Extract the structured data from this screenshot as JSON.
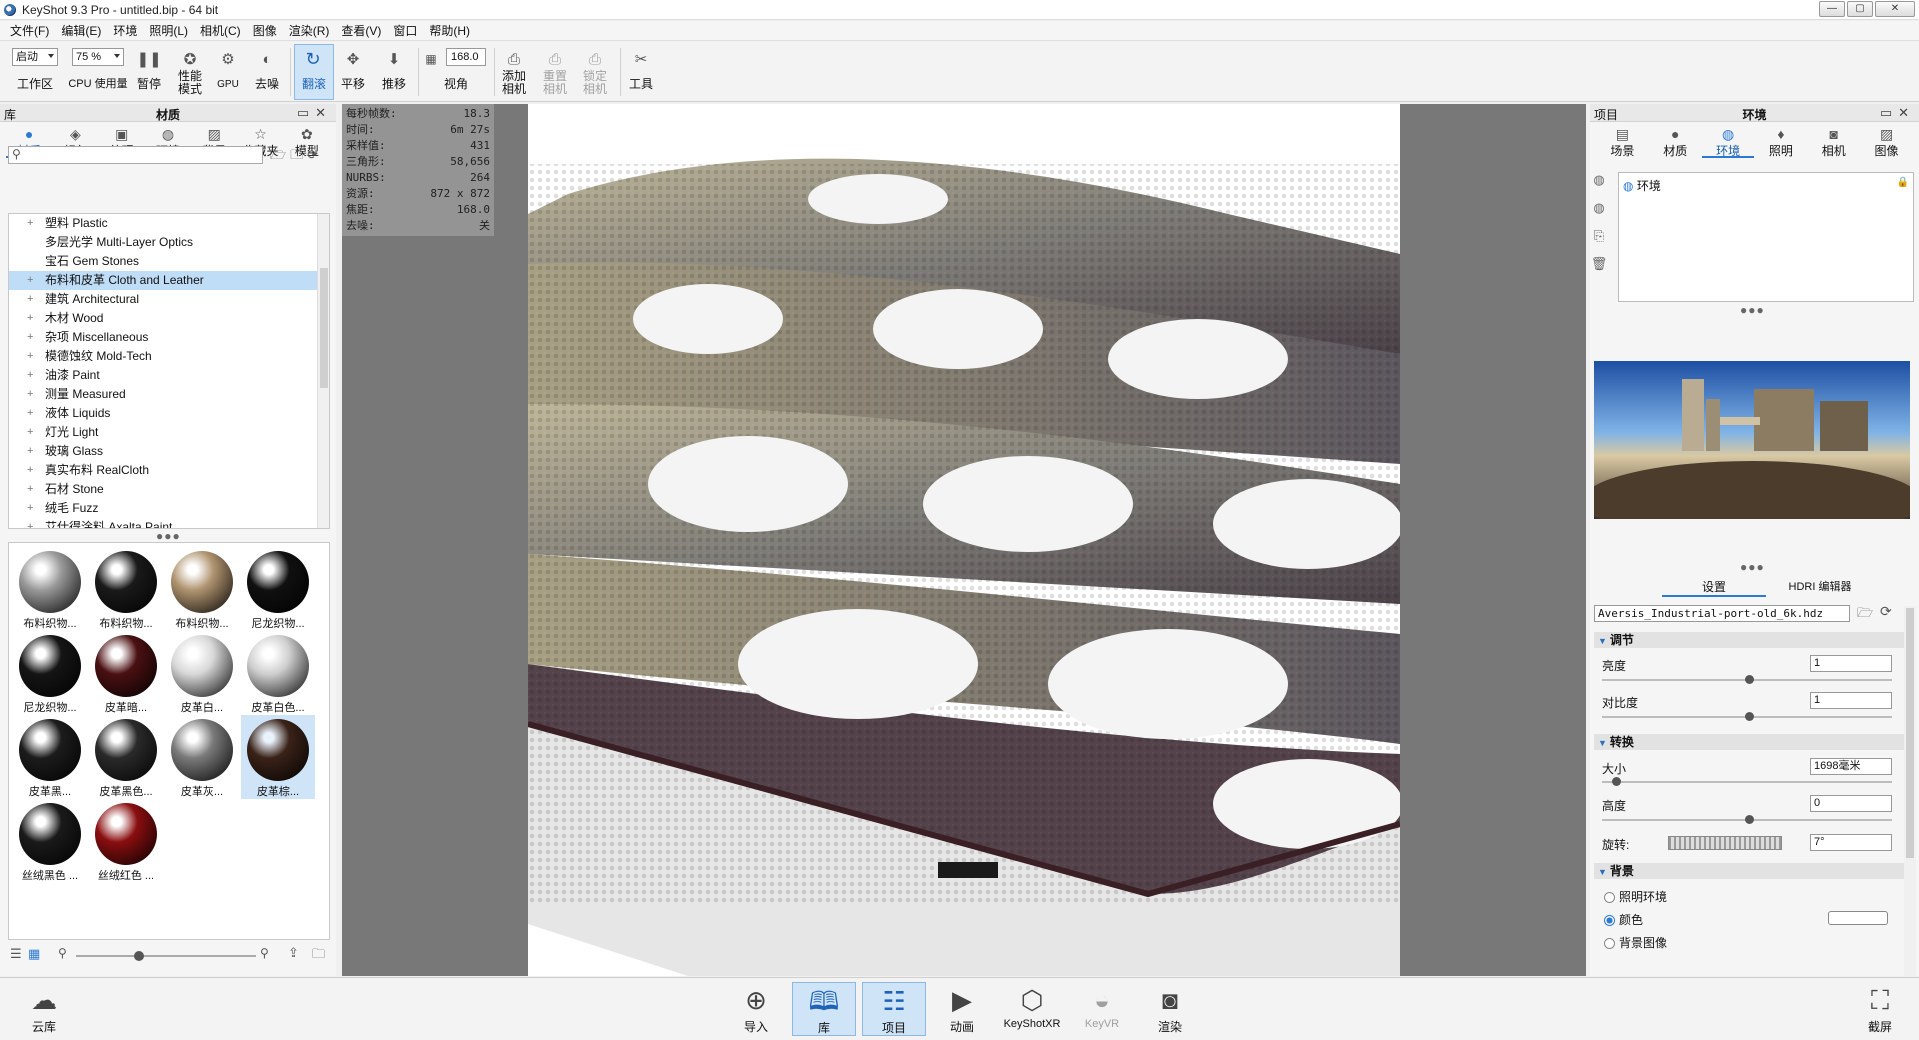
{
  "window": {
    "title": "KeyShot 9.3 Pro  - untitled.bip  - 64 bit",
    "min": "—",
    "max": "▢",
    "close": "✕"
  },
  "menu": [
    "文件(F)",
    "编辑(E)",
    "环境",
    "照明(L)",
    "相机(C)",
    "图像",
    "渲染(R)",
    "查看(V)",
    "窗口",
    "帮助(H)"
  ],
  "toolbar": {
    "workspace_select": "启动",
    "workspace_label": "工作区",
    "cpu_select": "75 %",
    "cpu_label": "CPU 使用量",
    "pause": "暂停",
    "perf_mode": "性能\n模式",
    "gpu": "GPU",
    "denoise": "去噪",
    "tumble": "翻滚",
    "pan": "平移",
    "dolly": "推移",
    "fov_value": "168.0",
    "fov_label": "视角",
    "add_camera": "添加\n相机",
    "reset_camera": "重置\n相机",
    "lock_camera": "锁定\n相机",
    "tools": "工具"
  },
  "library": {
    "header_left": "库",
    "header_center": "材质",
    "tabs": [
      "材质",
      "颜色",
      "纹理",
      "环境",
      "背景",
      "收藏夹",
      "模型"
    ],
    "search_placeholder": "",
    "tree": [
      "塑料 Plastic",
      "多层光学 Multi-Layer Optics",
      "宝石 Gem Stones",
      "布料和皮革 Cloth and Leather",
      "建筑 Architectural",
      "木材 Wood",
      "杂项 Miscellaneous",
      "模德蚀纹 Mold-Tech",
      "油漆 Paint",
      "测量 Measured",
      "液体 Liquids",
      "灯光 Light",
      "玻璃 Glass",
      "真实布料 RealCloth",
      "石材 Stone",
      "绒毛 Fuzz",
      "艾仕得涂料 Axalta Paint"
    ],
    "tree_plus": [
      "+",
      "",
      "",
      "+",
      "+",
      "+",
      "+",
      "+",
      "+",
      "+",
      "+",
      "+",
      "+",
      "+",
      "+",
      "+",
      "+"
    ],
    "thumbnails": [
      "布料织物...",
      "布料织物...",
      "布料织物...",
      "尼龙织物...",
      "尼龙织物...",
      "皮革暗...",
      "皮革白...",
      "皮革白色...",
      "皮革黑...",
      "皮革黑色...",
      "皮革灰...",
      "皮革棕...",
      "丝绒黑色 ...",
      "丝绒红色 ..."
    ],
    "thumb_colors": [
      "#9a9a9a",
      "#1a1a1a",
      "#b09470",
      "#101010",
      "#151515",
      "#4a1012",
      "#d8d8d8",
      "#cfcfcf",
      "#1c1c1c",
      "#2a2a2a",
      "#7a7a7a",
      "#3a2218",
      "#1a1a1a",
      "#8a0e10"
    ]
  },
  "hud": [
    {
      "k": "每秒帧数:",
      "v": "18.3"
    },
    {
      "k": "时间:",
      "v": "6m 27s"
    },
    {
      "k": "采样值:",
      "v": "431"
    },
    {
      "k": "三角形:",
      "v": "58,656"
    },
    {
      "k": "NURBS:",
      "v": "264"
    },
    {
      "k": "资源:",
      "v": "872 x 872"
    },
    {
      "k": "焦距:",
      "v": "168.0"
    },
    {
      "k": "去噪:",
      "v": "关"
    }
  ],
  "project": {
    "header_left": "项目",
    "header_center": "环境",
    "tabs": [
      "场景",
      "材质",
      "环境",
      "照明",
      "相机",
      "图像"
    ],
    "env_item": "环境",
    "subtabs": [
      "设置",
      "HDRI 编辑器"
    ],
    "hdri_file": "Aversis_Industrial-port-old_6k.hdz",
    "section_adjust": "调节",
    "brightness_label": "亮度",
    "brightness_value": "1",
    "contrast_label": "对比度",
    "contrast_value": "1",
    "section_transform": "转换",
    "size_label": "大小",
    "size_value": "1698毫米",
    "height_label": "高度",
    "height_value": "0",
    "rotation_label": "旋转:",
    "rotation_value": "7°",
    "section_background": "背景",
    "bg_lighting_env": "照明环境",
    "bg_color": "颜色",
    "bg_image": "背景图像"
  },
  "ribbon": {
    "cloud": "云库",
    "import": "导入",
    "library": "库",
    "project": "项目",
    "animation": "动画",
    "keyshotxr": "KeyShotXR",
    "keyvr": "KeyVR",
    "render": "渲染",
    "screenshot": "截屏"
  }
}
